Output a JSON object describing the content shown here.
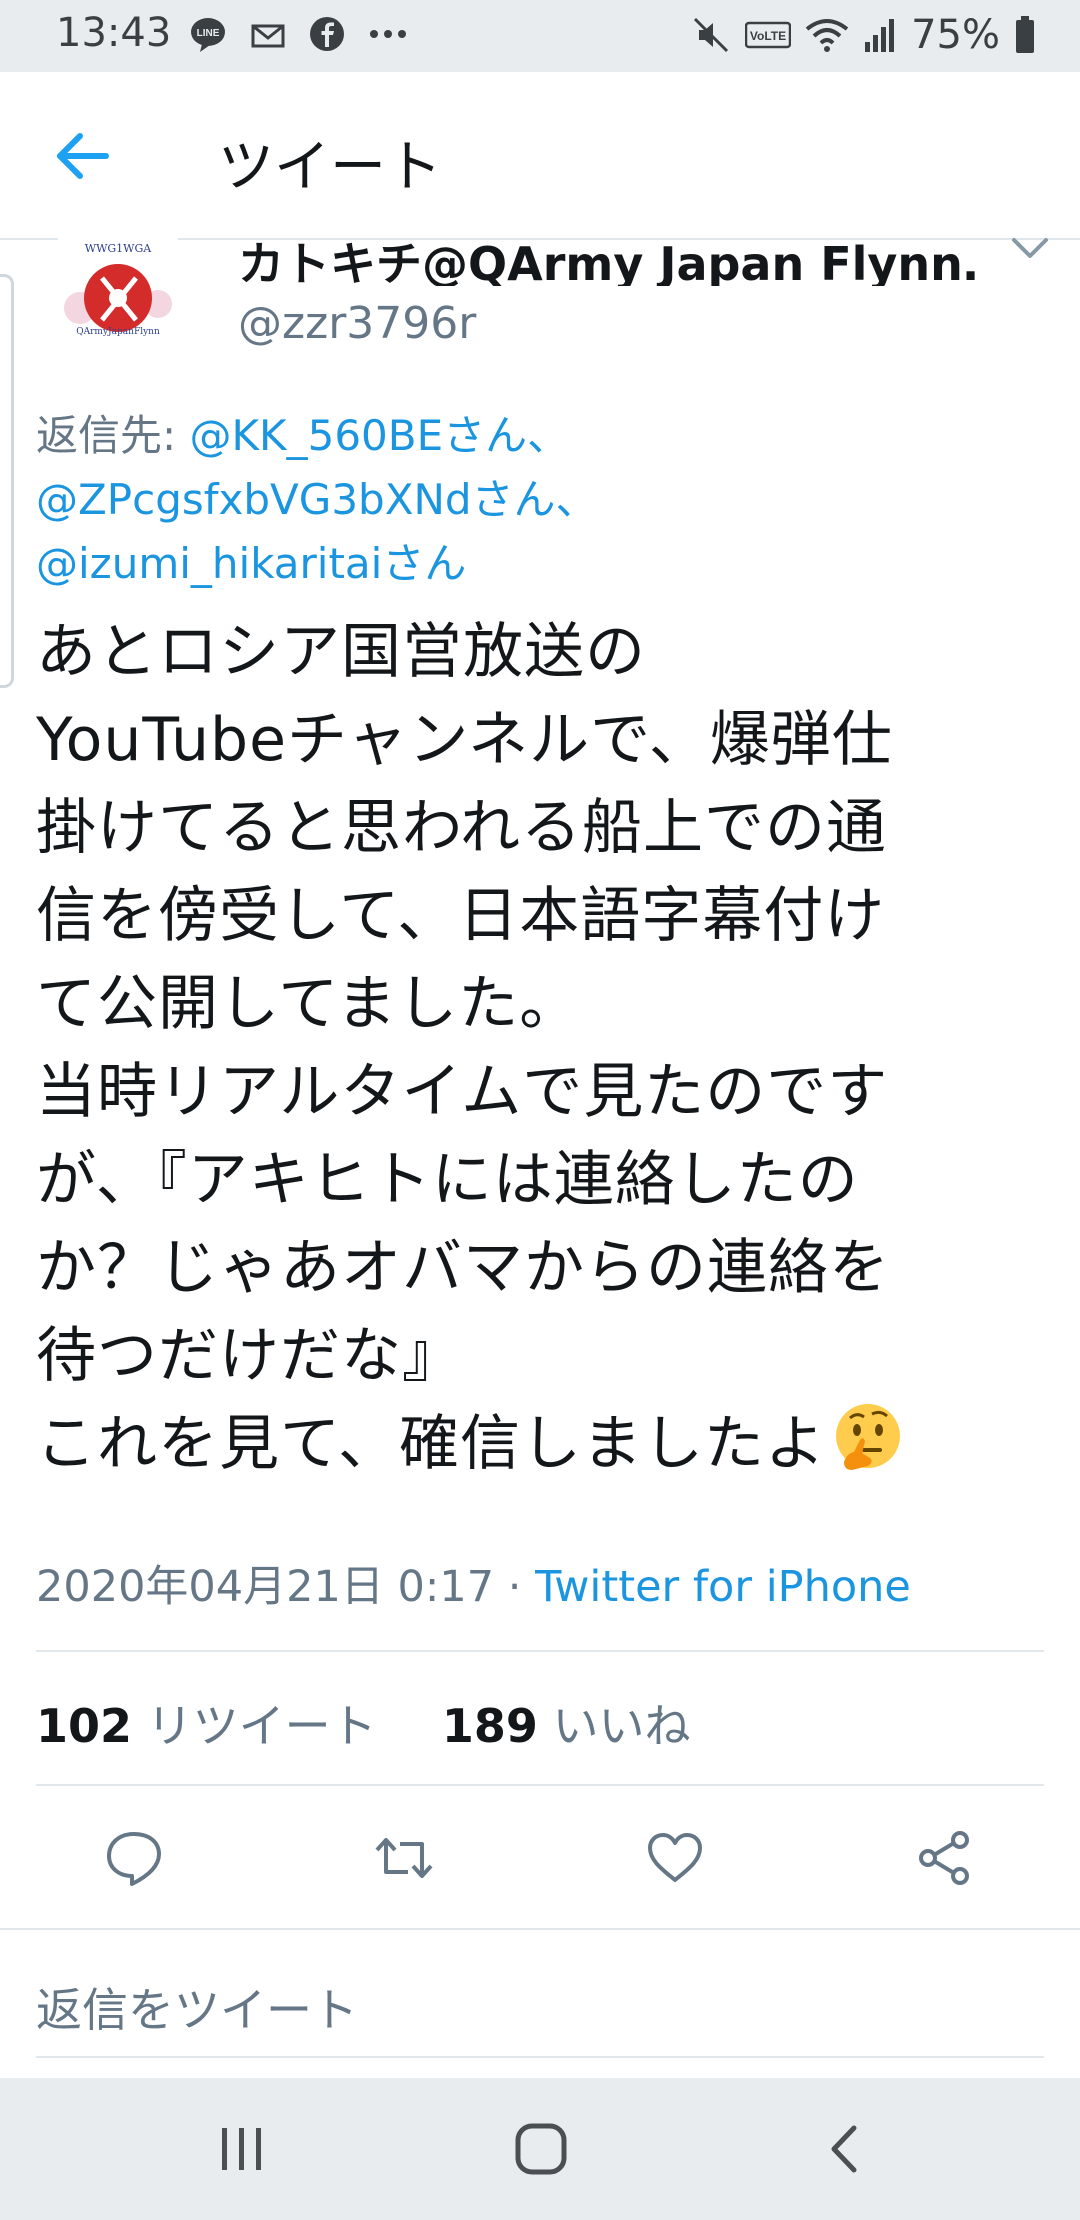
{
  "status_bar": {
    "time": "13:43",
    "battery": "75%",
    "left_icons": [
      "line-icon",
      "mail-icon",
      "facebook-icon",
      "more-dots-icon"
    ],
    "right_icons": [
      "mute-icon",
      "volte-icon",
      "wifi-icon",
      "signal-icon",
      "battery-icon"
    ]
  },
  "header": {
    "title": "ツイート",
    "back_icon": "back-arrow-icon"
  },
  "tweet": {
    "author_name": "カトキチ@QArmy Japan Flynn…",
    "author_handle": "@zzr3796r",
    "reply_to_label": "返信先: ",
    "reply_to_mentions": [
      "@KK_560BEさん、",
      "@ZPcgsfxbVG3bXNdさん、",
      "@izumi_hikaritaiさん"
    ],
    "body_lines": [
      "あとロシア国営放送の",
      "YouTubeチャンネルで、爆弾仕",
      "掛けてると思われる船上での通",
      "信を傍受して、日本語字幕付け",
      "て公開してました。",
      "当時リアルタイムで見たのです",
      "が、『アキヒトには連絡したの",
      "か？じゃあオバマからの連絡を",
      "待つだけだな』",
      "これを見て、確信しましたよ"
    ],
    "emoji": "thinking-face",
    "timestamp": "2020年04月21日 0:17 · ",
    "source": "Twitter for iPhone",
    "retweet_count": "102",
    "retweet_label": " リツイート",
    "like_count": "189",
    "like_label": " いいね"
  },
  "actions": [
    {
      "name": "reply",
      "icon": "reply-icon"
    },
    {
      "name": "retweet",
      "icon": "retweet-icon"
    },
    {
      "name": "like",
      "icon": "heart-icon"
    },
    {
      "name": "share",
      "icon": "share-icon"
    }
  ],
  "reply_composer": {
    "placeholder": "返信をツイート"
  },
  "nav_bar": {
    "buttons": [
      "recent-apps-icon",
      "home-icon",
      "back-icon"
    ]
  },
  "colors": {
    "accent": "#1b95e0",
    "secondary_text": "#657786",
    "primary_text": "#14171a",
    "system_bar": "#e9ecef"
  }
}
